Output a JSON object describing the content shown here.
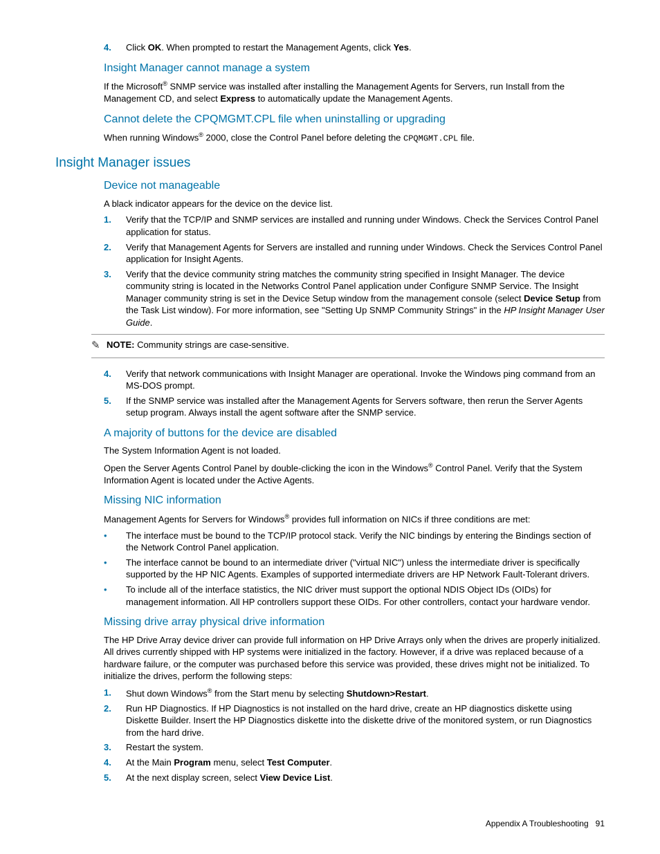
{
  "step4": {
    "num": "4.",
    "t1": "Click ",
    "b1": "OK",
    "t2": ". When prompted to restart the Management Agents, click ",
    "b2": "Yes",
    "t3": "."
  },
  "sec_cannot_manage": {
    "title": "Insight Manager cannot manage a system",
    "p1a": "If the Microsoft",
    "p1b": " SNMP service was installed after installing the Management Agents for Servers, run Install from the Management CD, and select ",
    "p1bold": "Express",
    "p1c": " to automatically update the Management Agents."
  },
  "sec_cannot_delete": {
    "title": "Cannot delete the CPQMGMT.CPL file when uninstalling or upgrading",
    "p1a": "When running Windows",
    "p1b": " 2000, close the Control Panel before deleting the ",
    "code": "CPQMGMT.CPL",
    "p1c": " file."
  },
  "h2_insight": "Insight Manager issues",
  "sec_dev_not_manage": {
    "title": "Device not manageable",
    "p1": "A black indicator appears for the device on the device list.",
    "li1": {
      "n": "1.",
      "t": "Verify that the TCP/IP and SNMP services are installed and running under Windows. Check the Services Control Panel application for status."
    },
    "li2": {
      "n": "2.",
      "t": "Verify that Management Agents for Servers are installed and running under Windows. Check the Services Control Panel application for Insight Agents."
    },
    "li3": {
      "n": "3.",
      "t1": "Verify that the device community string matches the community string specified in Insight Manager. The device community string is located in the Networks Control Panel application under Configure SNMP Service. The Insight Manager community string is set in the Device Setup window from the management console (select ",
      "b1": "Device Setup",
      "t2": " from the Task List window). For more information, see \"Setting Up SNMP Community Strings\" in the ",
      "i1": "HP Insight Manager User Guide",
      "t3": "."
    },
    "note_label": "NOTE:",
    "note_text": "  Community strings are case-sensitive.",
    "li4": {
      "n": "4.",
      "t": "Verify that network communications with Insight Manager are operational. Invoke the Windows ping command from an MS-DOS prompt."
    },
    "li5": {
      "n": "5.",
      "t": "If the SNMP service was installed after the Management Agents for Servers software, then rerun the Server Agents setup program. Always install the agent software after the SNMP service."
    }
  },
  "sec_buttons_disabled": {
    "title": "A majority of buttons for the device are disabled",
    "p1": "The System Information Agent is not loaded.",
    "p2a": "Open the Server Agents Control Panel by double-clicking the icon in the Windows",
    "p2b": " Control Panel. Verify that the System Information Agent is located under the Active Agents."
  },
  "sec_missing_nic": {
    "title": "Missing NIC information",
    "p1a": "Management Agents for Servers for Windows",
    "p1b": " provides full information on NICs if three conditions are met:",
    "li1": "The interface must be bound to the TCP/IP protocol stack. Verify the NIC bindings by entering the Bindings section of the Network Control Panel application.",
    "li2": "The interface cannot be bound to an intermediate driver (\"virtual NIC\") unless the intermediate driver is specifically supported by the HP NIC Agents. Examples of supported intermediate drivers are HP Network Fault-Tolerant drivers.",
    "li3": "To include all of the interface statistics, the NIC driver must support the optional NDIS Object IDs (OIDs) for management information. All HP controllers support these OIDs. For other controllers, contact your hardware vendor."
  },
  "sec_missing_drive": {
    "title": "Missing drive array physical drive information",
    "p1": "The HP Drive Array device driver can provide full information on HP Drive Arrays only when the drives are properly initialized. All drives currently shipped with HP systems were initialized in the factory. However, if a drive was replaced because of a hardware failure, or the computer was purchased before this service was provided, these drives might not be initialized. To initialize the drives, perform the following steps:",
    "li1": {
      "n": "1.",
      "t1": "Shut down Windows",
      "t2": " from the Start menu by selecting ",
      "b": "Shutdown>Restart",
      "t3": "."
    },
    "li2": {
      "n": "2.",
      "t": "Run HP Diagnostics. If HP Diagnostics is not installed on the hard drive, create an HP diagnostics diskette using Diskette Builder. Insert the HP Diagnostics diskette into the diskette drive of the monitored system, or run Diagnostics from the hard drive."
    },
    "li3": {
      "n": "3.",
      "t": "Restart the system."
    },
    "li4": {
      "n": "4.",
      "t1": "At the Main ",
      "b1": "Program",
      "t2": " menu, select ",
      "b2": "Test Computer",
      "t3": "."
    },
    "li5": {
      "n": "5.",
      "t1": "At the next display screen, select ",
      "b1": "View Device List",
      "t2": "."
    }
  },
  "footer": {
    "label": "Appendix A Troubleshooting",
    "page": "91"
  },
  "glyphs": {
    "reg": "®",
    "bullet": "•",
    "note_icon": "✎"
  }
}
